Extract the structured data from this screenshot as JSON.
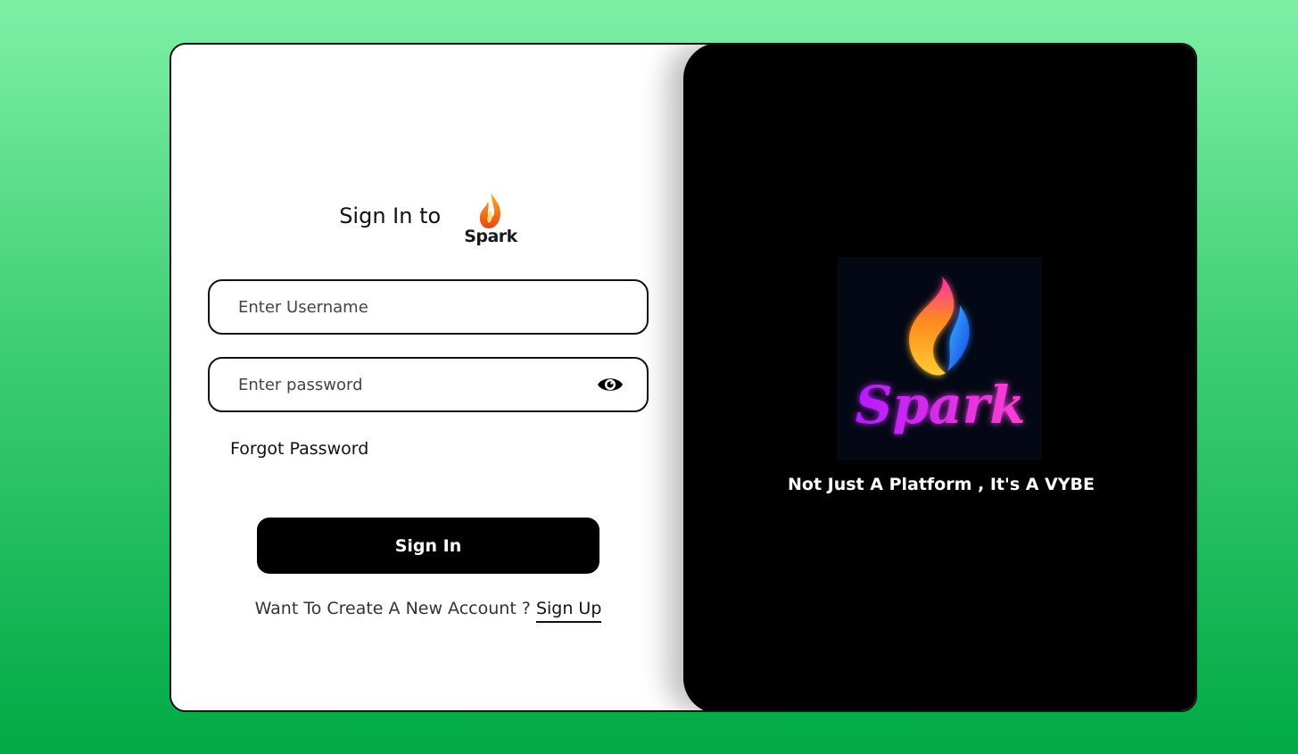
{
  "login": {
    "heading": "Sign In to",
    "brand_small": "Spark",
    "username_placeholder": "Enter Username",
    "password_placeholder": "Enter password",
    "forgot_label": "Forgot Password",
    "signin_label": "Sign In",
    "signup_prompt": "Want To Create A New Account ?",
    "signup_label": "Sign Up"
  },
  "promo": {
    "brand_large": "Spark",
    "tagline": "Not Just A Platform , It's A VYBE"
  },
  "icons": {
    "password_toggle": "eye-icon",
    "logo": "flame-icon"
  },
  "colors": {
    "background_top": "#7df0a6",
    "background_bottom": "#00aa45",
    "button": "#000000",
    "promo_panel": "#000000",
    "flame_orange": "#ff7a1a",
    "flame_blue": "#1e90ff",
    "brand_magenta": "#d12cf0"
  }
}
